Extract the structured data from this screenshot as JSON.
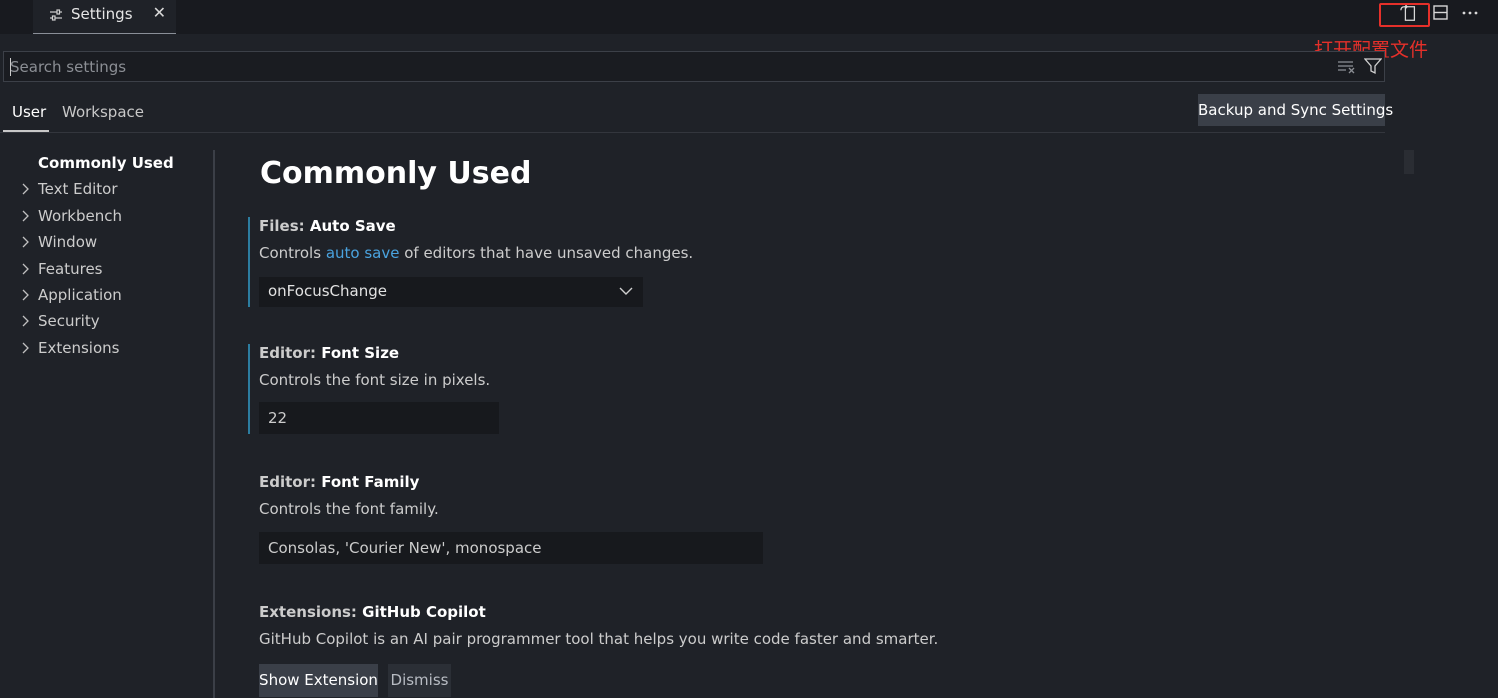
{
  "tab": {
    "label": "Settings",
    "close": "✕"
  },
  "annotation": {
    "text": "打开配置文件",
    "color": "#e5302a"
  },
  "search": {
    "placeholder": "Search settings",
    "value": ""
  },
  "scopes": {
    "user": "User",
    "workspace": "Workspace"
  },
  "sync_button": "Backup and Sync Settings",
  "toc": {
    "items": [
      {
        "label": "Commonly Used",
        "active": true
      },
      {
        "label": "Text Editor"
      },
      {
        "label": "Workbench"
      },
      {
        "label": "Window"
      },
      {
        "label": "Features"
      },
      {
        "label": "Application"
      },
      {
        "label": "Security"
      },
      {
        "label": "Extensions"
      }
    ]
  },
  "page_title": "Commonly Used",
  "settings": {
    "auto_save": {
      "category": "Files: ",
      "name": "Auto Save",
      "desc_before": "Controls ",
      "desc_link": "auto save",
      "desc_after": " of editors that have unsaved changes.",
      "value": "onFocusChange"
    },
    "font_size": {
      "category": "Editor: ",
      "name": "Font Size",
      "desc": "Controls the font size in pixels.",
      "value": "22"
    },
    "font_family": {
      "category": "Editor: ",
      "name": "Font Family",
      "desc": "Controls the font family.",
      "value": "Consolas, 'Courier New', monospace"
    },
    "copilot": {
      "category": "Extensions: ",
      "name": "GitHub Copilot",
      "desc": "GitHub Copilot is an AI pair programmer tool that helps you write code faster and smarter.",
      "primary_button": "Show Extension",
      "secondary_button": "Dismiss"
    }
  },
  "icons": {
    "tab": "settings-sliders-icon",
    "open_json": "open-settings-json-icon",
    "split": "split-editor-icon",
    "more": "more-actions-icon",
    "clear": "clear-filter-icon",
    "filter": "filter-icon",
    "chevron": "chevron-right-icon",
    "dropdown": "chevron-down-icon"
  },
  "colors": {
    "link": "#4aa3df",
    "modified_bar": "#2c7da0",
    "annotation": "#e5302a"
  }
}
